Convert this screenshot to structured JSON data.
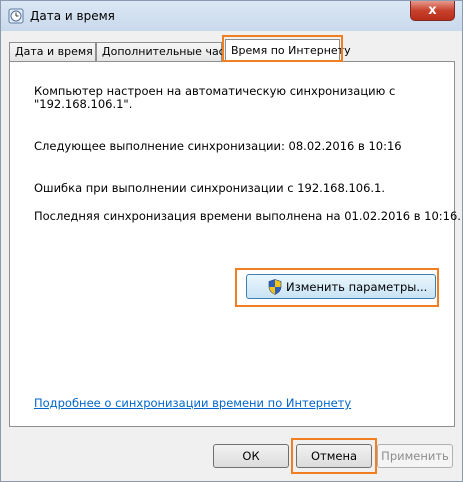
{
  "window": {
    "title": "Дата и время",
    "close_label": "x",
    "icon": "clock-icon"
  },
  "tabs": [
    {
      "label": "Дата и время",
      "selected": false
    },
    {
      "label": "Дополнительные часы",
      "selected": false
    },
    {
      "label": "Время по Интернету",
      "selected": true
    }
  ],
  "panel": {
    "configured_text_line1": "Компьютер настроен на автоматическую синхронизацию с",
    "configured_text_line2": "\"192.168.106.1\".",
    "next_sync_text": "Следующее выполнение синхронизации: 08.02.2016 в 10:16",
    "error_text": "Ошибка при выполнении синхронизации с 192.168.106.1.",
    "last_sync_text": "Последняя синхронизация времени выполнена на 01.02.2016 в 10:16.",
    "change_button_label": "Изменить параметры...",
    "change_button_icon": "uac-shield-icon",
    "more_link_text": "Подробнее о синхронизации времени по Интернету"
  },
  "buttons": {
    "ok": "ОК",
    "cancel": "Отмена",
    "apply": "Применить"
  },
  "colors": {
    "highlight": "#f07f24",
    "link": "#0066cc",
    "close": "#c8412d"
  }
}
